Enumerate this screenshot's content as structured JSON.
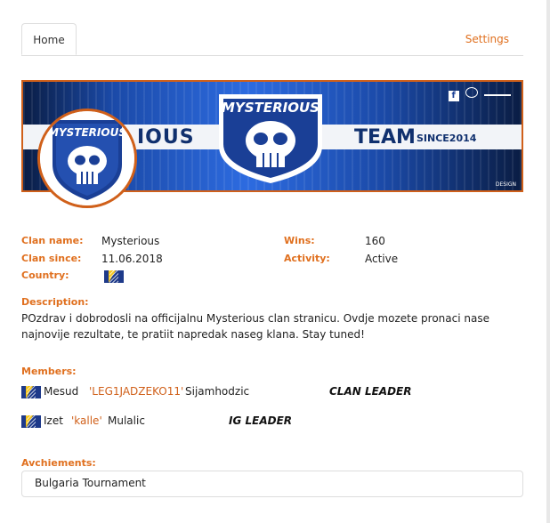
{
  "tabs": {
    "home": "Home",
    "settings": "Settings"
  },
  "banner": {
    "center_logo_text": "MYSTERIOUS",
    "left_text": "IOUS",
    "right_text": "TEAM",
    "since_text": "SINCE2014",
    "design_credit": "DESIGN"
  },
  "avatar": {
    "logo_text": "MYSTERIOUS"
  },
  "colors": {
    "accent": "#e0701f",
    "banner_border": "#d0601a",
    "navy": "#10306e"
  },
  "info": {
    "clan_name_label": "Clan name:",
    "clan_name": "Mysterious",
    "clan_since_label": "Clan since:",
    "clan_since": "11.06.2018",
    "country_label": "Country:",
    "country_flag": "bosnia-flag-icon",
    "wins_label": "Wins:",
    "wins": "160",
    "activity_label": "Activity:",
    "activity": "Active"
  },
  "description": {
    "label": "Description:",
    "text": "POzdrav i dobrodosli na officijalnu Mysterious clan stranicu. Ovdje mozete pronaci nase najnovije rezultate, te pratiit napredak naseg klana. Stay tuned!"
  },
  "members": {
    "label": "Members:",
    "list": [
      {
        "first": "Mesud",
        "nick": "'LEG1JADZEKO11'",
        "last": "Sijamhodzic",
        "role": "CLAN LEADER"
      },
      {
        "first": "Izet",
        "nick": "'kalle'",
        "last": "Mulalic",
        "role": "IG LEADER"
      }
    ]
  },
  "achievements": {
    "label": "Avchiements:",
    "items": [
      "Bulgaria Tournament"
    ]
  }
}
